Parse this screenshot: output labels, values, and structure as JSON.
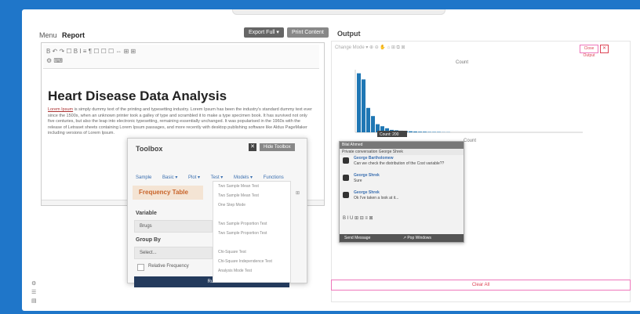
{
  "left": {
    "breadcrumb_root": "Menu",
    "breadcrumb_current": "Report",
    "btn_export": "Export Full ▾",
    "btn_print": "Print Content",
    "toolbar_row1": "B  ↶  ↷  ☐  B  I  ≡  ¶  ☐  ☐ ☐  ⇔  ⊞ ⊞",
    "toolbar_row2": "⚙  ⌨",
    "doc_title": "Heart Disease Data Analysis",
    "doc_lead": "Lorem Ipsum",
    "doc_text": " is simply dummy text of the printing and typesetting industry. Lorem Ipsum has been the industry's standard dummy text ever since the 1500s, when an unknown printer took a galley of type and scrambled it to make a type specimen book. It has survived not only five centuries, but also the leap into electronic typesetting, remaining essentially unchanged. It was popularised in the 1960s with the release of Letraset sheets containing Lorem Ipsum passages, and more recently with desktop publishing software like Aldus PageMaker including versions of Lorem Ipsum."
  },
  "toolbox": {
    "title": "Toolbox",
    "close_icon": "✕",
    "hide_label": "Hide Toolbox",
    "tabs": [
      "Sample",
      "Basic ▾",
      "Plot ▾",
      "Test ▾",
      "Models ▾",
      "Functions"
    ],
    "analysis": "Frequency Table",
    "variable_label": "Variable",
    "variable_value": "Brugs",
    "group_label": "Group By",
    "group_value": "Select...",
    "relative_label": "Relative Frequency",
    "run_label": "Run",
    "menu_items": [
      "Two Sample Mean Test",
      "Two Sample Mean Test",
      "One Step Mode",
      "",
      "Two Sample Proportion Test",
      "Two Sample Proportion Test",
      "",
      "Chi-Square Test",
      "Chi-Square Independence Test",
      "Analysis Mode Test"
    ]
  },
  "output": {
    "title": "Output",
    "toolbar_text": "Change Mode ▾  ⊕  ⊖  ✋  ⌂  ⊞  ⧉  ⊠",
    "close_label": "Close Output",
    "x_label": "✕",
    "clear_label": "Clear All"
  },
  "chart_data": {
    "type": "bar",
    "title": "Count",
    "xlabel": "Count",
    "ylabel": "",
    "categories": [
      "1",
      "2",
      "3",
      "4",
      "5",
      "6",
      "7",
      "8",
      "9",
      "10",
      "11",
      "12",
      "13",
      "14",
      "15",
      "16",
      "17",
      "18",
      "19",
      "20"
    ],
    "values": [
      290,
      260,
      120,
      80,
      40,
      30,
      20,
      12,
      10,
      8,
      6,
      5,
      4,
      3,
      3,
      2,
      2,
      2,
      1,
      1
    ],
    "ylim": [
      0,
      300
    ],
    "tooltip_text": "Count: 200",
    "colors": {
      "bar": "#1f77b4"
    }
  },
  "chat": {
    "header": "Bilal Ahmed",
    "subheader": "Private conversation George Shrek",
    "messages": [
      {
        "name": "George Bartholomew",
        "text": "Can we check the distribution of the Cost variable??"
      },
      {
        "name": "George Shrek",
        "text": "Sure"
      },
      {
        "name": "George Shrek",
        "text": "Ok I've taken a look at it..."
      }
    ],
    "tools": "B  I  U  ⊞  ⊟  ≡  ⊠",
    "footer_send": "Send Message",
    "footer_open": "↗ Pop Windows"
  },
  "left_icons": [
    "⚙",
    "☰",
    "▤"
  ]
}
